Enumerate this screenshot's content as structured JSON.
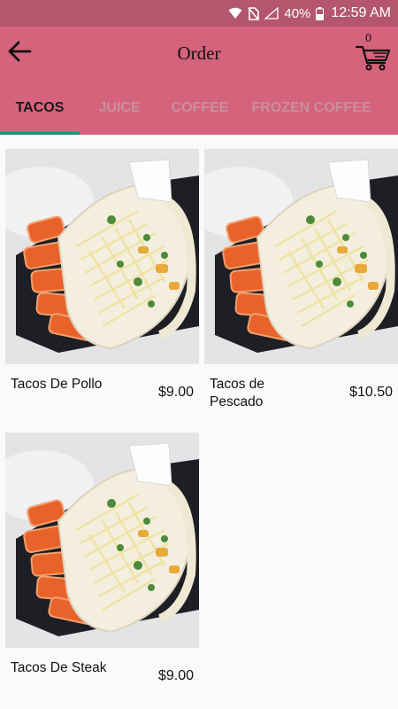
{
  "status_bar": {
    "battery": "40%",
    "time": "12:59 AM",
    "icons": [
      "wifi-icon",
      "no-sim-icon",
      "signal-icon",
      "battery-icon"
    ]
  },
  "header": {
    "title": "Order",
    "cart_count": "0",
    "icons": [
      "back-arrow-icon",
      "cart-icon"
    ]
  },
  "tabs": [
    {
      "label": "TACOS",
      "active": true
    },
    {
      "label": "JUICE",
      "active": false
    },
    {
      "label": "COFFEE",
      "active": false
    },
    {
      "label": "FROZEN COFFEE",
      "active": false
    }
  ],
  "products": [
    {
      "name": "Tacos De Pollo",
      "price": "$9.00"
    },
    {
      "name": "Tacos de Pescado",
      "price": "$10.50"
    },
    {
      "name": "Tacos De Steak",
      "price": "$9.00"
    }
  ],
  "colors": {
    "status_bar": "#b3566e",
    "app_bar": "#d5637c",
    "tab_active": "#1a1a1a",
    "tab_inactive": "#c9909e",
    "tab_indicator": "#1f8f78",
    "background": "#fafafa"
  }
}
